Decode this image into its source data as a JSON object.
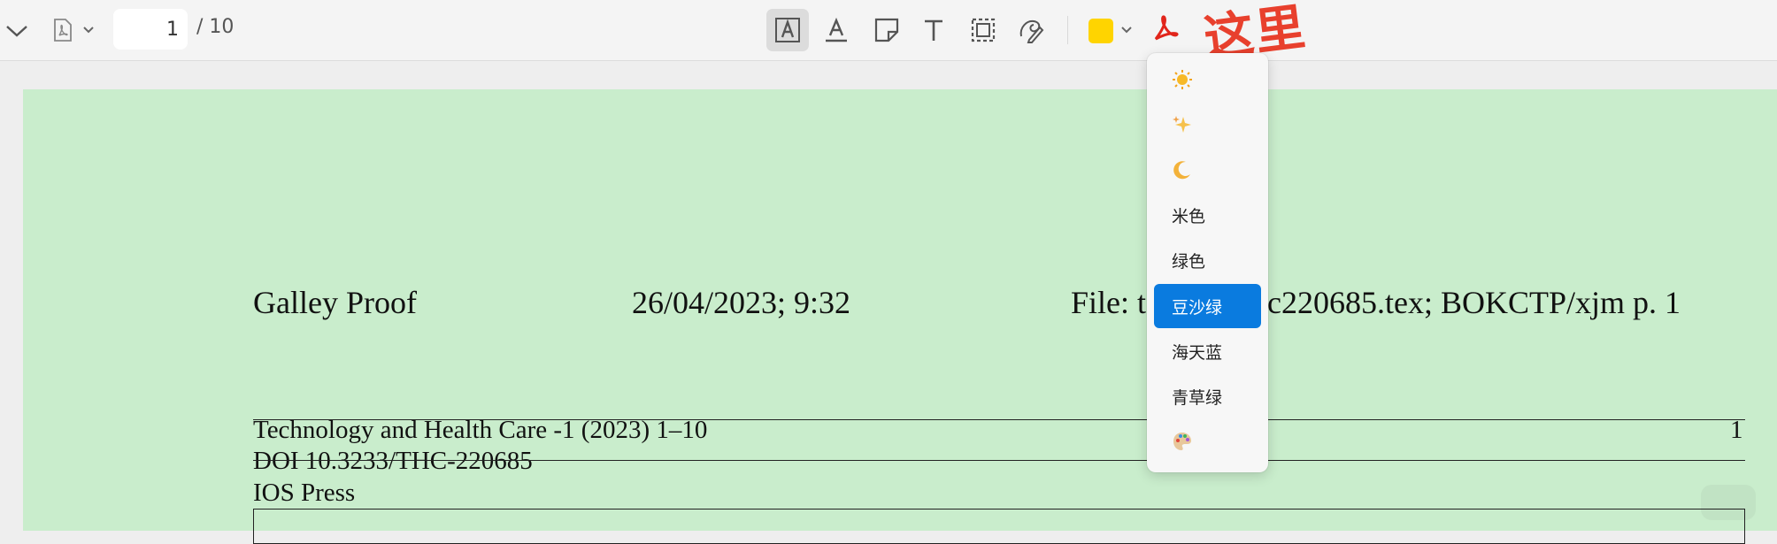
{
  "toolbar": {
    "page_current": "1",
    "page_total": "/ 10",
    "swatch_color": "#ffd400",
    "tools": [
      "highlight-text-icon",
      "underline-text-icon",
      "note-icon",
      "text-icon",
      "crop-select-icon",
      "signature-icon"
    ]
  },
  "annotation": {
    "text": "这里",
    "color": "#e8402d"
  },
  "document": {
    "background": "#c9edcc",
    "header_left": "Galley Proof",
    "header_mid": "26/04/2023; 9:32",
    "header_right_a": "File: t",
    "header_right_b": "c220685.tex; BOKCTP/xjm p. 1",
    "journal_line": "Technology and Health Care -1 (2023) 1–10",
    "page_number": "1",
    "doi_line": "DOI 10.3233/THC-220685",
    "publisher_line": "IOS Press"
  },
  "theme_menu": {
    "items": [
      {
        "label": "",
        "icon": "sun-icon"
      },
      {
        "label": "",
        "icon": "sparkles-icon"
      },
      {
        "label": "",
        "icon": "moon-icon"
      },
      {
        "label": "米色"
      },
      {
        "label": "绿色"
      },
      {
        "label": "豆沙绿",
        "selected": true
      },
      {
        "label": "海天蓝"
      },
      {
        "label": "青草绿"
      },
      {
        "label": "",
        "icon": "palette-icon"
      }
    ]
  }
}
